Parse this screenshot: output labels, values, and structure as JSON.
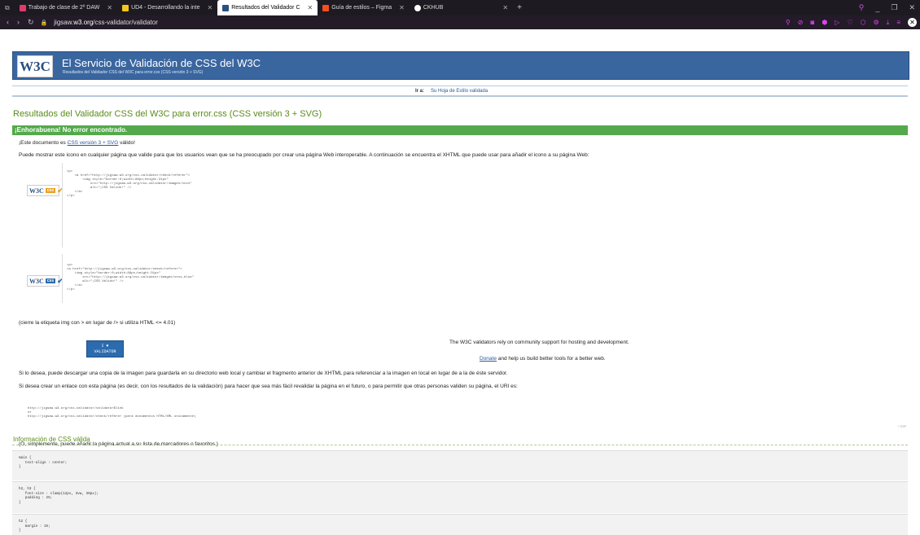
{
  "browser": {
    "tabs": [
      {
        "label": "Trabajo de clase de 2º DAW",
        "color": "#e03b6a",
        "active": false
      },
      {
        "label": "UD4 - Desarrollando la inte",
        "color": "#f5c518",
        "active": false
      },
      {
        "label": "Resultados del Validador C",
        "color": "#2a4f80",
        "active": true
      },
      {
        "label": "Guía de estilos – Figma",
        "color": "#f24e1e",
        "active": false
      },
      {
        "label": "CKHUB",
        "color": "#ffffff",
        "active": false
      }
    ],
    "url_prefix": "jigsaw.",
    "url_domain": "w3.org",
    "url_path": "/css-validator/validator"
  },
  "banner": {
    "logo": "W3C",
    "title": "El Servicio de Validación de CSS del W3C",
    "subtitle": "Resultados del Validador CSS del W3C para error.css (CSS versión 3 + SVG)"
  },
  "goto": {
    "label": "Ir a:",
    "link": "Su Hoja de Estilo validada"
  },
  "results_title": "Resultados del Validador CSS del W3C para error.css (CSS versión 3 + SVG)",
  "congrats": "¡Enhorabuena! No error encontrado.",
  "valid_line": {
    "before": "¡Este documento es ",
    "link": "CSS versión 3 + SVG",
    "after": " válido!"
  },
  "icon_text": "Puede mostrar este icono en cualquier página que valide para que los usuarios vean que se ha preocupado por crear una página Web interoperable. A continuación se encuentra el XHTML que puede usar para añadir el icono a su página Web:",
  "code1": "<p>\n    <a href=\"http://jigsaw.w3.org/css-validator/check/referer\">\n        <img style=\"border:0;width:88px;height:31px\"\n            src=\"http://jigsaw.w3.org/css-validator/images/vcss\"\n            alt=\"¡CSS Válido!\" />\n    </a>\n</p>",
  "code2": "<p>\n<a href=\"http://jigsaw.w3.org/css-validator/check/referer\">\n    <img style=\"border:0;width:88px;height:31px\"\n        src=\"http://jigsaw.w3.org/css-validator/images/vcss-blue\"\n        alt=\"¡CSS Válido!\" />\n    </a>\n</p>",
  "badge": {
    "w3c": "W3C",
    "css1": "css",
    "css2": "css"
  },
  "img_note": "(cierre la etiqueta img con > en lugar de /> si utiliza HTML <= 4.01)",
  "validator_button": {
    "line1": "I ♥",
    "line2": "VALIDATOR"
  },
  "community": "The W3C validators rely on community support for hosting and development.",
  "donate": {
    "link": "Donate",
    "rest": " and help us build better tools for a better web."
  },
  "download_text": "Si lo desea, puede descargar una copia de la imagen para guardarla en su directorio web local y cambiar el fragmento anterior de XHTML para referenciar a la imagen en local en lugar de a la de éste servidor.",
  "link_text": "Si desea crear un enlace con esta página (es decir, con los resultados de la validación) para hacer que sea más fácil revalidar la página en el futuro, o para permitir que otras personas validen su página, el URI es:",
  "uri_code": "http://jigsaw.w3.org/css-validator/validator$link\nor\nhttp://jigsaw.w3.org/css-validator/check/referer (para documentos HTML/XML únicamente)",
  "bookmark": "(O, simplemente, puede añadir la página actual a su lista de marcadores o favoritos.)",
  "top_link": "↑ TOP",
  "valid_css_title": "Información de CSS válida",
  "css_rules": [
    "main {\n   text-align : center;\n}",
    "h2, h3 {\n   font-size : clamp(12px, 3vw, 30px);\n   padding : 25;\n}",
    "h2 {\n   margin : 15;\n}"
  ]
}
